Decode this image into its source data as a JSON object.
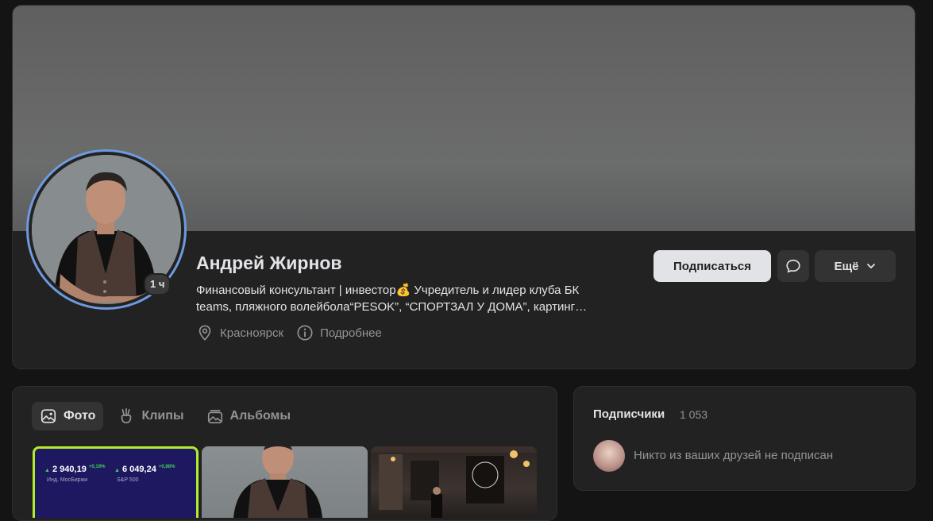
{
  "profile": {
    "name": "Андрей Жирнов",
    "status_line1": "Финансовый консультант | инвестор💰 Учредитель и лидер клуба БК",
    "status_line2": "teams, пляжного волейбола“PESOK”, “СПОРТЗАЛ У ДОМА”, картинг…",
    "online": "1 ч",
    "city": "Красноярск",
    "details": "Подробнее"
  },
  "actions": {
    "subscribe": "Подписаться",
    "more": "Ещё"
  },
  "tabs": [
    {
      "label": "Фото",
      "icon": "image-icon",
      "active": true
    },
    {
      "label": "Клипы",
      "icon": "clips-icon",
      "active": false
    },
    {
      "label": "Альбомы",
      "icon": "albums-icon",
      "active": false
    }
  ],
  "photo_widget": {
    "moex_value": "2 940,19",
    "moex_change": "+0,19%",
    "moex_label": "Инд. МосБиржи",
    "sp_value": "6 049,24",
    "sp_change": "+0,88%",
    "sp_label": "S&P 500"
  },
  "subscribers": {
    "title": "Подписчики",
    "count": "1 053",
    "note": "Никто из ваших друзей не подписан"
  },
  "colors": {
    "accent_ring": "#6f9ae0",
    "widget_border": "#b3ec2a",
    "up": "#3ecf5a"
  }
}
